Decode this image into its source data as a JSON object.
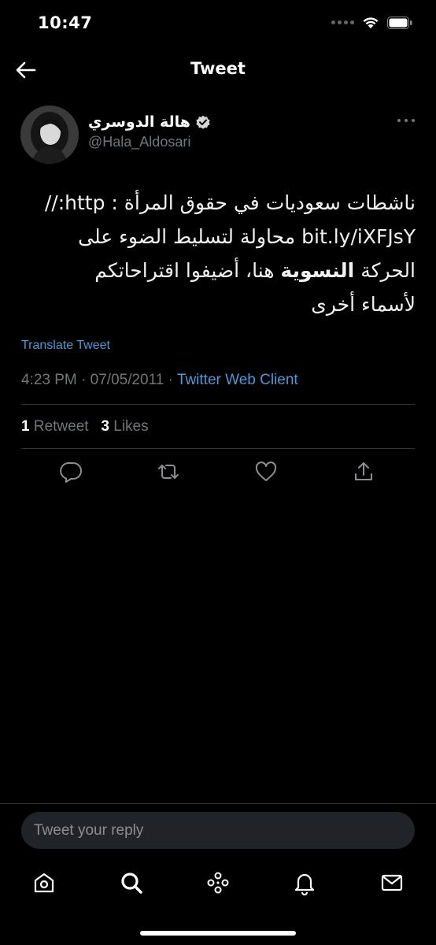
{
  "status_bar": {
    "time": "10:47"
  },
  "header": {
    "title": "Tweet"
  },
  "author": {
    "display_name": "هالة الدوسري",
    "handle": "@Hala_Aldosari",
    "verified": true
  },
  "tweet": {
    "line1": "ناشطات سعوديات في حقوق المرأة : http://",
    "line2": "bit.ly/iXFJsY محاولة لتسليط الضوء على",
    "line3_bold": "النسوية",
    "line3_pre": "الحركة ",
    "line3_post": " هنا، أضيفوا اقتراحاتكم",
    "line4": "لأسماء أخرى"
  },
  "translate_label": "Translate Tweet",
  "meta": {
    "time": "4:23 PM",
    "separator": " · ",
    "date": "07/05/2011",
    "client": "Twitter Web Client"
  },
  "stats": {
    "retweets_count": "1",
    "retweets_label": "Retweet",
    "likes_count": "3",
    "likes_label": "Likes"
  },
  "reply": {
    "placeholder": "Tweet your reply"
  },
  "icons": {
    "back": "arrow-left-icon",
    "more": "more-horizontal-icon",
    "reply": "comment-icon",
    "retweet": "retweet-icon",
    "like": "heart-icon",
    "share": "share-icon",
    "home": "home-icon",
    "search": "search-icon",
    "spaces": "spaces-icon",
    "notifications": "bell-icon",
    "messages": "mail-icon"
  },
  "colors": {
    "background": "#000000",
    "link": "#4a9ad8",
    "secondary": "#71767b"
  }
}
